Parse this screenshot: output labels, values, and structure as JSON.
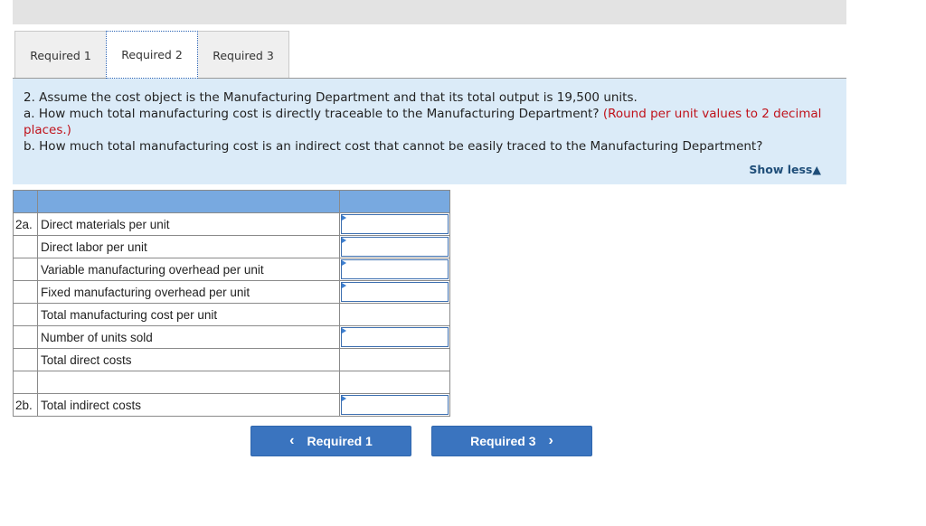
{
  "tabs": [
    {
      "label": "Required 1",
      "active": false
    },
    {
      "label": "Required 2",
      "active": true
    },
    {
      "label": "Required 3",
      "active": false
    }
  ],
  "question": {
    "line1": "2. Assume the cost object is the Manufacturing Department and that its total output is 19,500 units.",
    "line2a": "a. How much total manufacturing cost is directly traceable to the Manufacturing Department? ",
    "line2a_note": "(Round per unit values to 2 decimal places.)",
    "line3": "b. How much total manufacturing cost is an indirect cost that cannot be easily traced to the Manufacturing Department?",
    "show_less": "Show less▲"
  },
  "table": {
    "rows": [
      {
        "prefix": "2a.",
        "label": "Direct materials per unit",
        "input": true,
        "value": ""
      },
      {
        "prefix": "",
        "label": "Direct labor per unit",
        "input": true,
        "value": ""
      },
      {
        "prefix": "",
        "label": "Variable manufacturing overhead per unit",
        "input": true,
        "value": ""
      },
      {
        "prefix": "",
        "label": "Fixed manufacturing overhead per unit",
        "input": true,
        "value": ""
      },
      {
        "prefix": "",
        "label": "Total manufacturing cost per unit",
        "input": false,
        "value": ""
      },
      {
        "prefix": "",
        "label": "Number of units sold",
        "input": true,
        "value": ""
      },
      {
        "prefix": "",
        "label": "Total direct costs",
        "input": false,
        "value": ""
      },
      {
        "prefix": "",
        "label": "",
        "input": false,
        "value": ""
      },
      {
        "prefix": "2b.",
        "label": "Total indirect costs",
        "input": true,
        "value": ""
      }
    ]
  },
  "nav": {
    "prev_label": "Required 1",
    "prev_icon": "‹",
    "next_label": "Required 3",
    "next_icon": "›"
  }
}
